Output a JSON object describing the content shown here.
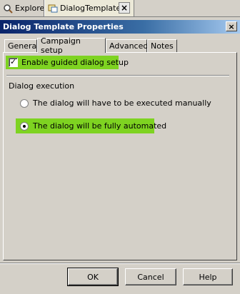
{
  "editor_tabs": [
    {
      "label": "Explore"
    },
    {
      "label": "DialogTemplate"
    }
  ],
  "editor_close_label": "×",
  "dialog": {
    "title": "Dialog Template Properties",
    "close_label": "×"
  },
  "tabs": [
    {
      "label": "General"
    },
    {
      "label": "Campaign setup"
    },
    {
      "label": "Advanced"
    },
    {
      "label": "Notes"
    }
  ],
  "campaign": {
    "guided_checkbox_label": "Enable guided dialog setup",
    "guided_checked_mark": "✓",
    "execution_group_label": "Dialog execution",
    "radio_manual_label": "The dialog will have to be executed manually",
    "radio_auto_label": "The dialog will be fully automated",
    "selected": "auto"
  },
  "buttons": {
    "ok": "OK",
    "cancel": "Cancel",
    "help": "Help"
  },
  "colors": {
    "highlight": "#7ed321",
    "title_start": "#0a246a",
    "title_end": "#a6caf0"
  }
}
